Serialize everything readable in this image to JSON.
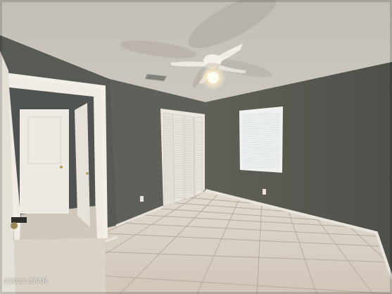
{
  "photo": {
    "watermark": "©2024 CPAR"
  },
  "colors": {
    "ceiling": "#c9c4bd",
    "left_wall": "#595c55",
    "back_wall": "#5e6059",
    "right_wall": "#5a5c55",
    "floor_tile": "#d9d2c7",
    "grout": "#b5ad9f",
    "trim": "#ebe7e0",
    "door": "#eeeae3",
    "window_glow": "#eef1f2"
  }
}
